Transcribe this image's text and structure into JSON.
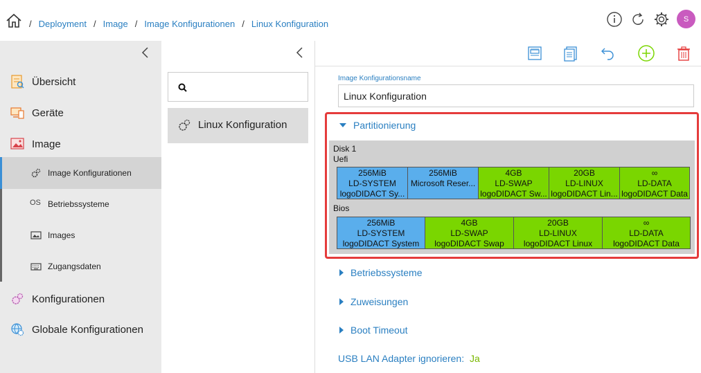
{
  "breadcrumb": {
    "separator": "/",
    "items": [
      "Deployment",
      "Image",
      "Image Konfigurationen",
      "Linux Konfiguration"
    ]
  },
  "user": {
    "avatar_initial": "S"
  },
  "sidebar": {
    "items": [
      {
        "label": "Übersicht",
        "icon": "overview-icon"
      },
      {
        "label": "Geräte",
        "icon": "devices-icon"
      },
      {
        "label": "Image",
        "icon": "image-icon"
      },
      {
        "label": "Image Konfigurationen",
        "icon": "gears-icon",
        "sub": true,
        "active": true
      },
      {
        "label": "Betriebssysteme",
        "icon": "os-icon",
        "sub": true,
        "icon_text": "OS"
      },
      {
        "label": "Images",
        "icon": "picture-icon",
        "sub": true
      },
      {
        "label": "Zugangsdaten",
        "icon": "keyboard-icon",
        "sub": true
      },
      {
        "label": "Konfigurationen",
        "icon": "config-icon"
      },
      {
        "label": "Globale Konfigurationen",
        "icon": "global-config-icon"
      }
    ]
  },
  "list": {
    "search_placeholder": "",
    "items": [
      {
        "label": "Linux Konfiguration"
      }
    ]
  },
  "form": {
    "name_label": "Image Konfigurationsname",
    "name_value": "Linux Konfiguration"
  },
  "sections": {
    "partitionierung": "Partitionierung",
    "betriebssysteme": "Betriebssysteme",
    "zuweisungen": "Zuweisungen",
    "boot_timeout": "Boot Timeout"
  },
  "partitions": {
    "disk": "Disk 1",
    "uefi_label": "Uefi",
    "bios_label": "Bios",
    "uefi": [
      {
        "size": "256MiB",
        "name": "LD-SYSTEM",
        "desc": "logoDIDACT Sy...",
        "color": "blue"
      },
      {
        "size": "256MiB",
        "name": "",
        "desc": "Microsoft Reser...",
        "color": "blue"
      },
      {
        "size": "4GB",
        "name": "LD-SWAP",
        "desc": "logoDIDACT Sw...",
        "color": "green"
      },
      {
        "size": "20GB",
        "name": "LD-LINUX",
        "desc": "logoDIDACT Lin...",
        "color": "green"
      },
      {
        "size": "∞",
        "name": "LD-DATA",
        "desc": "logoDIDACT Data",
        "color": "green"
      }
    ],
    "bios": [
      {
        "size": "256MiB",
        "name": "LD-SYSTEM",
        "desc": "logoDIDACT System",
        "color": "blue"
      },
      {
        "size": "4GB",
        "name": "LD-SWAP",
        "desc": "logoDIDACT Swap",
        "color": "green"
      },
      {
        "size": "20GB",
        "name": "LD-LINUX",
        "desc": "logoDIDACT Linux",
        "color": "green"
      },
      {
        "size": "∞",
        "name": "LD-DATA",
        "desc": "logoDIDACT Data",
        "color": "green"
      }
    ]
  },
  "usb": {
    "label": "USB LAN Adapter ignorieren:",
    "value": "Ja"
  },
  "colors": {
    "accent": "#2a7fc1",
    "highlight": "#e53b3b",
    "blue_partition": "#5aaeec",
    "green_partition": "#7ad600",
    "add": "#7ad600",
    "delete": "#e53b3b"
  }
}
